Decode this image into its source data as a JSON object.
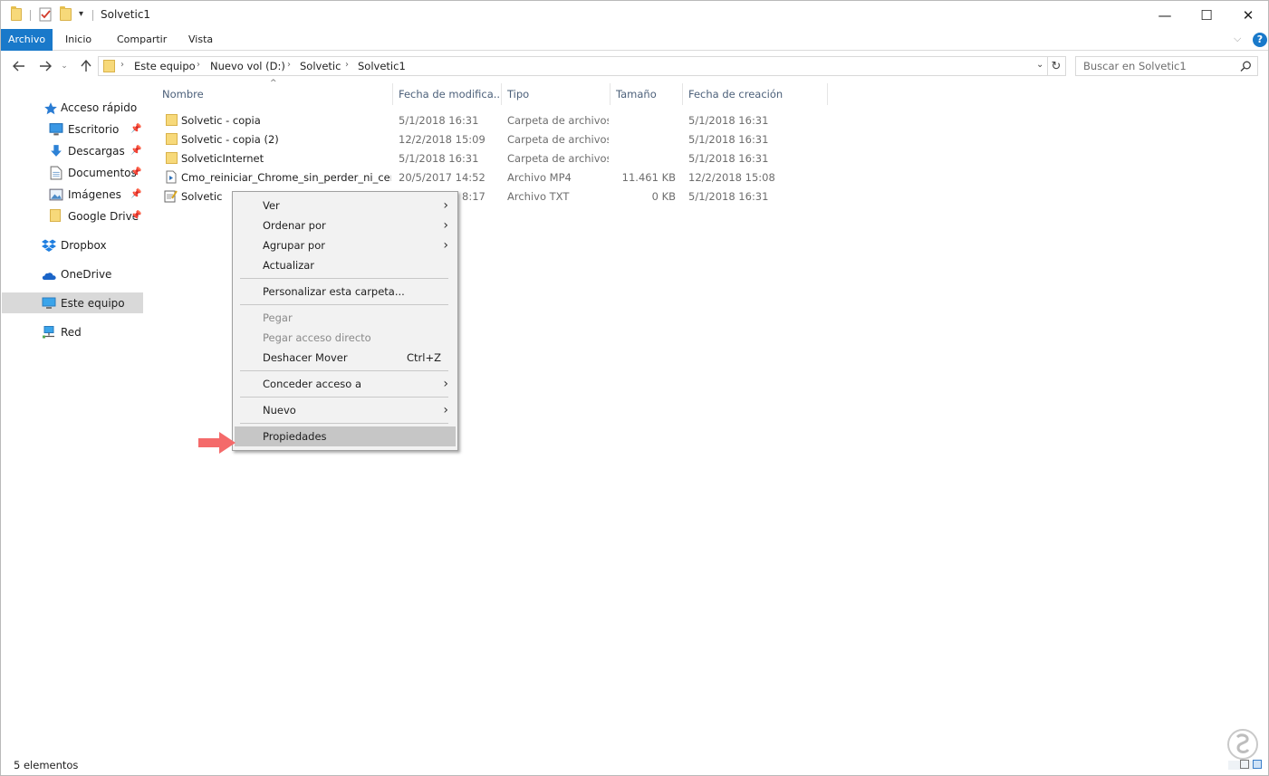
{
  "window": {
    "title": "Solvetic1",
    "controls": {
      "minimize": "—",
      "maximize": "☐",
      "close": "✕"
    }
  },
  "ribbon": {
    "tabs": [
      "Archivo",
      "Inicio",
      "Compartir",
      "Vista"
    ],
    "active_tab": "Archivo",
    "help_label": "?",
    "accent": "#1979ca"
  },
  "address": {
    "crumbs": [
      "Este equipo",
      "Nuevo vol (D:)",
      "Solvetic",
      "Solvetic1"
    ]
  },
  "search": {
    "placeholder": "Buscar en Solvetic1"
  },
  "nav": {
    "items": [
      {
        "label": "Acceso rápido",
        "icon": "star-icon"
      },
      {
        "label": "Escritorio",
        "icon": "desktop-icon",
        "pinned": true
      },
      {
        "label": "Descargas",
        "icon": "download-arrow-icon",
        "pinned": true
      },
      {
        "label": "Documentos",
        "icon": "document-icon",
        "pinned": true
      },
      {
        "label": "Imágenes",
        "icon": "pictures-icon",
        "pinned": true
      },
      {
        "label": "Google Drive",
        "icon": "folder-icon",
        "pinned": true
      },
      {
        "label": "Dropbox",
        "icon": "dropbox-icon"
      },
      {
        "label": "OneDrive",
        "icon": "cloud-icon"
      },
      {
        "label": "Este equipo",
        "icon": "computer-icon",
        "selected": true
      },
      {
        "label": "Red",
        "icon": "network-icon"
      }
    ]
  },
  "columns": [
    "Nombre",
    "Fecha de modifica...",
    "Tipo",
    "Tamaño",
    "Fecha de creación"
  ],
  "files": [
    {
      "name": "Solvetic - copia",
      "modified": "5/1/2018 16:31",
      "type": "Carpeta de archivos",
      "size": "",
      "created": "5/1/2018 16:31",
      "icon": "folder-icon"
    },
    {
      "name": "Solvetic - copia (2)",
      "modified": "12/2/2018 15:09",
      "type": "Carpeta de archivos",
      "size": "",
      "created": "5/1/2018 16:31",
      "icon": "folder-icon"
    },
    {
      "name": "SolveticInternet",
      "modified": "5/1/2018 16:31",
      "type": "Carpeta de archivos",
      "size": "",
      "created": "5/1/2018 16:31",
      "icon": "folder-icon"
    },
    {
      "name": "Cmo_reiniciar_Chrome_sin_perder_ni_cer...",
      "modified": "20/5/2017 14:52",
      "type": "Archivo MP4",
      "size": "11.461 KB",
      "created": "12/2/2018 15:08",
      "icon": "video-file-icon"
    },
    {
      "name": "Solvetic",
      "modified": "8:17",
      "type": "Archivo TXT",
      "size": "0 KB",
      "created": "5/1/2018 16:31",
      "icon": "text-file-icon"
    }
  ],
  "context_menu": {
    "items": [
      {
        "label": "Ver",
        "submenu": true
      },
      {
        "label": "Ordenar por",
        "submenu": true
      },
      {
        "label": "Agrupar por",
        "submenu": true
      },
      {
        "label": "Actualizar"
      },
      {
        "label": "Personalizar esta carpeta..."
      },
      {
        "label": "Pegar",
        "disabled": true
      },
      {
        "label": "Pegar acceso directo",
        "disabled": true
      },
      {
        "label": "Deshacer Mover",
        "shortcut": "Ctrl+Z"
      },
      {
        "label": "Conceder acceso a",
        "submenu": true
      },
      {
        "label": "Nuevo",
        "submenu": true
      },
      {
        "label": "Propiedades",
        "highlighted": true
      }
    ]
  },
  "status": {
    "text": "5 elementos"
  },
  "annotation": {
    "pointer_color": "#f46a6a"
  }
}
